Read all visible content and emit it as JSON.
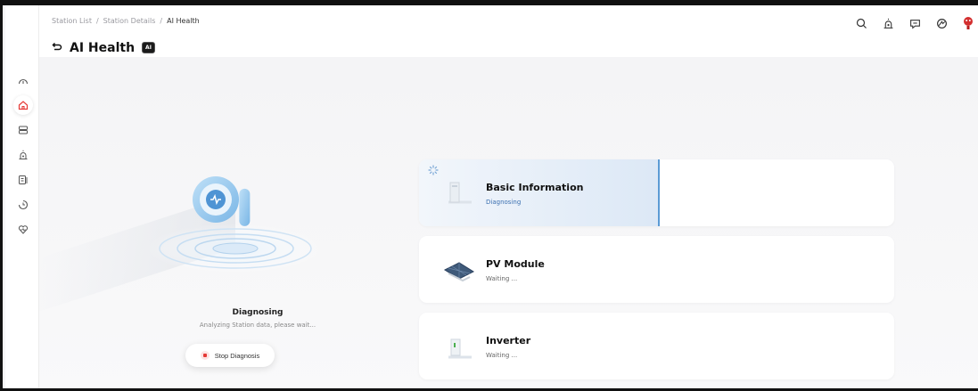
{
  "breadcrumb": [
    "Station List",
    "Station Details",
    "AI Health"
  ],
  "breadcrumb_sep": "/",
  "page": {
    "title": "AI Health",
    "badge": "AI"
  },
  "header_icons": [
    "search-icon",
    "alarm-icon",
    "message-icon",
    "settings-icon",
    "avatar"
  ],
  "sidebar": {
    "items": [
      {
        "name": "dashboard-icon",
        "active": false
      },
      {
        "name": "station-icon",
        "active": true
      },
      {
        "name": "devices-icon",
        "active": false
      },
      {
        "name": "alarm-icon",
        "active": false
      },
      {
        "name": "report-icon",
        "active": false
      },
      {
        "name": "history-icon",
        "active": false
      },
      {
        "name": "health-icon",
        "active": false
      }
    ]
  },
  "diagnosis": {
    "title": "Diagnosing",
    "subtitle": "Analyzing Station data, please wait...",
    "stop_label": "Stop Diagnosis"
  },
  "cards": [
    {
      "title": "Basic Information",
      "status": "Diagnosing",
      "active": true,
      "progress_fraction": 0.5
    },
    {
      "title": "PV Module",
      "status": "Waiting ...",
      "active": false
    },
    {
      "title": "Inverter",
      "status": "Waiting ...",
      "active": false
    }
  ],
  "colors": {
    "accent": "#e53935",
    "progress": "#5b9bd5",
    "status_active": "#3a6fb0"
  }
}
